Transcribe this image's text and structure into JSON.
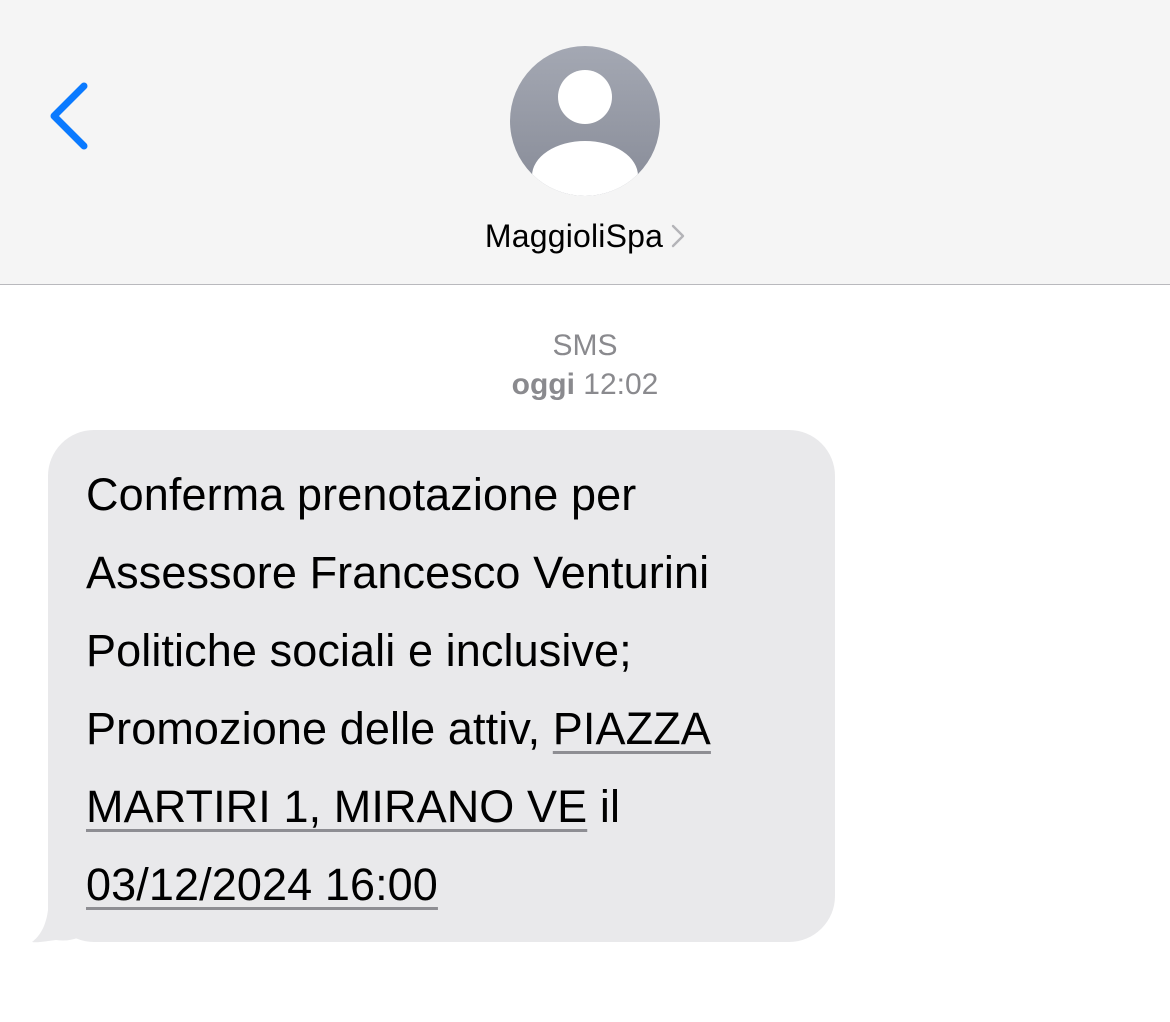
{
  "header": {
    "contact_name": "MaggioliSpa",
    "back_icon": "chevron-left-icon",
    "avatar_icon": "person-silhouette-icon",
    "disclosure_icon": "chevron-right-icon"
  },
  "thread": {
    "service": "SMS",
    "day": "oggi",
    "time": "12:02"
  },
  "message": {
    "line1": "Conferma prenotazione per",
    "line2": "Assessore Francesco Venturini",
    "line3": "Politiche sociali e inclusive;",
    "line4_text": "Promozione delle attiv, ",
    "address_part1": "PIAZZA",
    "address_part2": "MARTIRI 1, MIRANO VE",
    "line5_suffix": " il",
    "datetime": "03/12/2024 16:00"
  },
  "colors": {
    "accent": "#0a7aff",
    "header_bg": "#f5f5f5",
    "bubble_bg": "#e9e9eb",
    "meta_text": "#8a8a8e",
    "avatar_top": "#a4a8b3",
    "avatar_bottom": "#878b97"
  }
}
